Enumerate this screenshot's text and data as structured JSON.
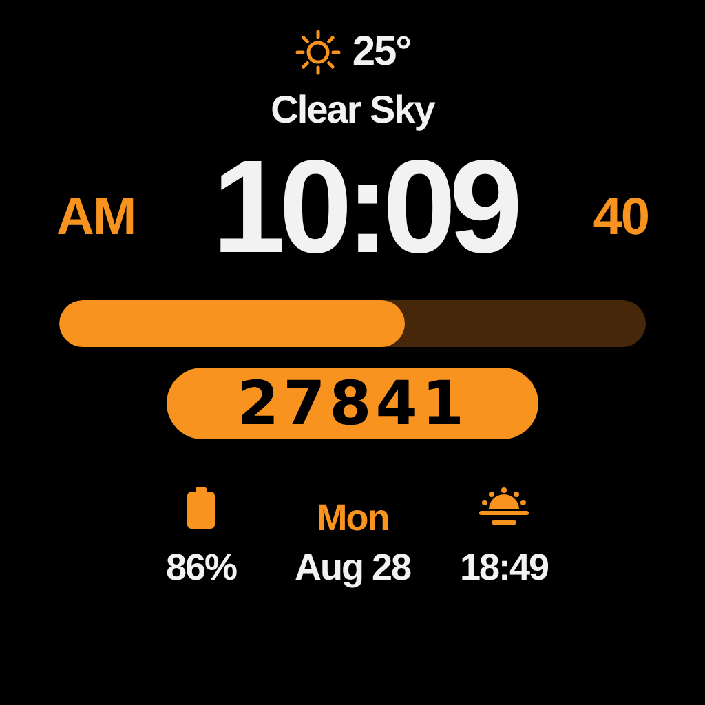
{
  "weather": {
    "temperature": "25°",
    "condition": "Clear Sky"
  },
  "time": {
    "period": "AM",
    "clock": "10:09",
    "seconds": "40"
  },
  "progress": {
    "level": 0.59
  },
  "steps": "27841",
  "stats": [
    {
      "kind": "battery",
      "value": "86%"
    },
    {
      "kind": "date",
      "label": "Mon",
      "value": "Aug 28"
    },
    {
      "kind": "sunset",
      "value": "18:49"
    }
  ]
}
